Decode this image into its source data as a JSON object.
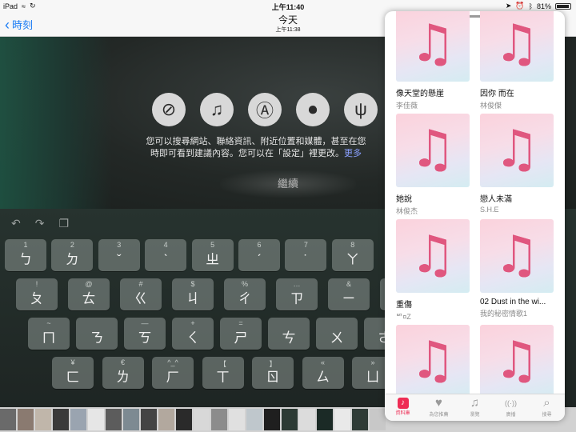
{
  "status": {
    "device": "iPad",
    "time": "上午11:40",
    "battery": "81%",
    "battery_level": 0.81
  },
  "nav": {
    "back": "時刻",
    "title": "今天",
    "subtitle": "上午11:38"
  },
  "suggestions": {
    "text_line1": "您可以搜尋網站、聯絡資訊、附近位置和媒體，甚至在您",
    "text_line2a": "時即可看到建議內容。您可以在「設定」裡更改。",
    "text_more": "更多",
    "continue": "繼續"
  },
  "keyboard": {
    "row1": [
      {
        "top": "1",
        "main": "ㄅ"
      },
      {
        "top": "2",
        "main": "ㄉ"
      },
      {
        "top": "3",
        "main": "ˇ"
      },
      {
        "top": "4",
        "main": "ˋ"
      },
      {
        "top": "5",
        "main": "ㄓ"
      },
      {
        "top": "6",
        "main": "ˊ"
      },
      {
        "top": "7",
        "main": "˙"
      },
      {
        "top": "8",
        "main": "ㄚ"
      }
    ],
    "row2": [
      {
        "top": "!",
        "main": "ㄆ"
      },
      {
        "top": "@",
        "main": "ㄊ"
      },
      {
        "top": "#",
        "main": "ㄍ"
      },
      {
        "top": "$",
        "main": "ㄐ"
      },
      {
        "top": "%",
        "main": "ㄔ"
      },
      {
        "top": "…",
        "main": "ㄗ"
      },
      {
        "top": "&",
        "main": "ㄧ"
      },
      {
        "top": "*",
        "main": "ㄛ"
      }
    ],
    "row3": [
      {
        "top": "~",
        "main": "ㄇ"
      },
      {
        "top": "",
        "main": "ㄋ"
      },
      {
        "top": "—",
        "main": "ㄎ"
      },
      {
        "top": "+",
        "main": "ㄑ"
      },
      {
        "top": "=",
        "main": "ㄕ"
      },
      {
        "top": "",
        "main": "ㄘ"
      },
      {
        "top": "",
        "main": "ㄨ"
      },
      {
        "top": "",
        "main": "ㄜ"
      }
    ],
    "row4": [
      {
        "top": "¥",
        "main": "ㄈ"
      },
      {
        "top": "€",
        "main": "ㄌ"
      },
      {
        "top": "^_^",
        "main": "ㄏ"
      },
      {
        "top": "【",
        "main": "ㄒ"
      },
      {
        "top": "】",
        "main": "ㄖ"
      },
      {
        "top": "«",
        "main": "ㄙ"
      },
      {
        "top": "»",
        "main": "ㄩ"
      }
    ]
  },
  "music": {
    "albums": [
      {
        "title": "像天堂的懸崖",
        "artist": "李佳薇"
      },
      {
        "title": "因你 而在",
        "artist": "林俊傑"
      },
      {
        "title": "她說",
        "artist": "林俊杰"
      },
      {
        "title": "戀人未滿",
        "artist": "S.H.E"
      },
      {
        "title": "重傷",
        "artist": "ᄢ¤Z"
      },
      {
        "title": "02 Dust in the wi...",
        "artist": "我的秘密情歌1"
      },
      {
        "title": "",
        "artist": ""
      },
      {
        "title": "",
        "artist": ""
      }
    ],
    "tabs": [
      {
        "icon": "♪",
        "label": "資料庫"
      },
      {
        "icon": "♥",
        "label": "為您推薦"
      },
      {
        "icon": "♫",
        "label": "瀏覽"
      },
      {
        "icon": "((·))",
        "label": "廣播"
      },
      {
        "icon": "⌕",
        "label": "搜尋"
      }
    ]
  },
  "colors": {
    "accent": "#1a7cf5",
    "music_accent": "#ee2d55"
  }
}
